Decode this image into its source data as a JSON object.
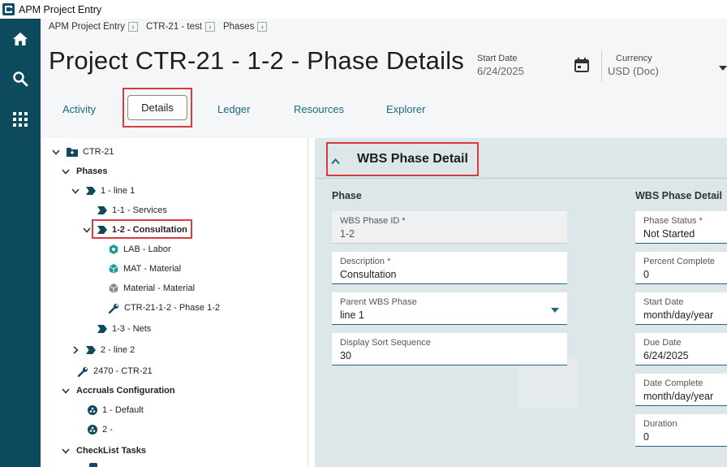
{
  "app": {
    "title": "APM Project Entry"
  },
  "breadcrumb": [
    "APM Project Entry",
    "CTR-21 - test",
    "Phases"
  ],
  "page_title": "Project CTR-21 - 1-2 - Phase Details",
  "header": {
    "start_date": {
      "label": "Start Date",
      "value": "6/24/2025"
    },
    "currency": {
      "label": "Currency",
      "value": "USD (Doc)"
    }
  },
  "tabs": [
    "Activity",
    "Details",
    "Ledger",
    "Resources",
    "Explorer"
  ],
  "active_tab": "Details",
  "rail": [
    "home-icon",
    "search-icon",
    "apps-grid-icon"
  ],
  "tree": [
    {
      "label": "CTR-21",
      "icon": "folder-icon"
    },
    {
      "label": "Phases",
      "icon": ""
    },
    {
      "label": "1 - line 1",
      "icon": "phase-tag-icon"
    },
    {
      "label": "1-1 - Services",
      "icon": "phase-tag-icon"
    },
    {
      "label": "1-2 - Consultation",
      "icon": "phase-tag-icon"
    },
    {
      "label": "LAB - Labor",
      "icon": "labor-resource-icon"
    },
    {
      "label": "MAT - Material",
      "icon": "material-resource-icon"
    },
    {
      "label": "Material - Material",
      "icon": "material-resource-icon"
    },
    {
      "label": "CTR-21-1-2 - Phase 1-2",
      "icon": "wrench-icon"
    },
    {
      "label": "1-3 - Nets",
      "icon": "phase-tag-icon"
    },
    {
      "label": "2 - line 2",
      "icon": "phase-tag-icon"
    },
    {
      "label": "2470 - CTR-21",
      "icon": "wrench-icon"
    },
    {
      "label": "Accruals Configuration",
      "icon": ""
    },
    {
      "label": "1 - Default",
      "icon": "accrual-icon"
    },
    {
      "label": "2 -",
      "icon": "accrual-icon"
    },
    {
      "label": "CheckList Tasks",
      "icon": ""
    }
  ],
  "panel": {
    "title": "WBS Phase Detail",
    "left_section": "Phase",
    "right_section": "WBS Phase Detail",
    "left_fields": [
      {
        "label": "WBS Phase ID *",
        "value": "1-2"
      },
      {
        "label": "Description *",
        "value": "Consultation"
      },
      {
        "label": "Parent WBS Phase",
        "value": "line 1"
      },
      {
        "label": "Display Sort Sequence",
        "value": "30"
      }
    ],
    "right_fields": [
      {
        "label": "Phase Status *",
        "value": "Not Started"
      },
      {
        "label": "Percent Complete",
        "value": "0"
      },
      {
        "label": "Start Date",
        "value": "month/day/year"
      },
      {
        "label": "Due Date",
        "value": "6/24/2025"
      },
      {
        "label": "Date Complete",
        "value": "month/day/year"
      },
      {
        "label": "Duration",
        "value": "0"
      }
    ]
  },
  "colors": {
    "rail": "#0d4a5e",
    "accent": "#1b6a84",
    "highlight_box": "#d93c3c",
    "panel_bg": "#dde7ea"
  }
}
